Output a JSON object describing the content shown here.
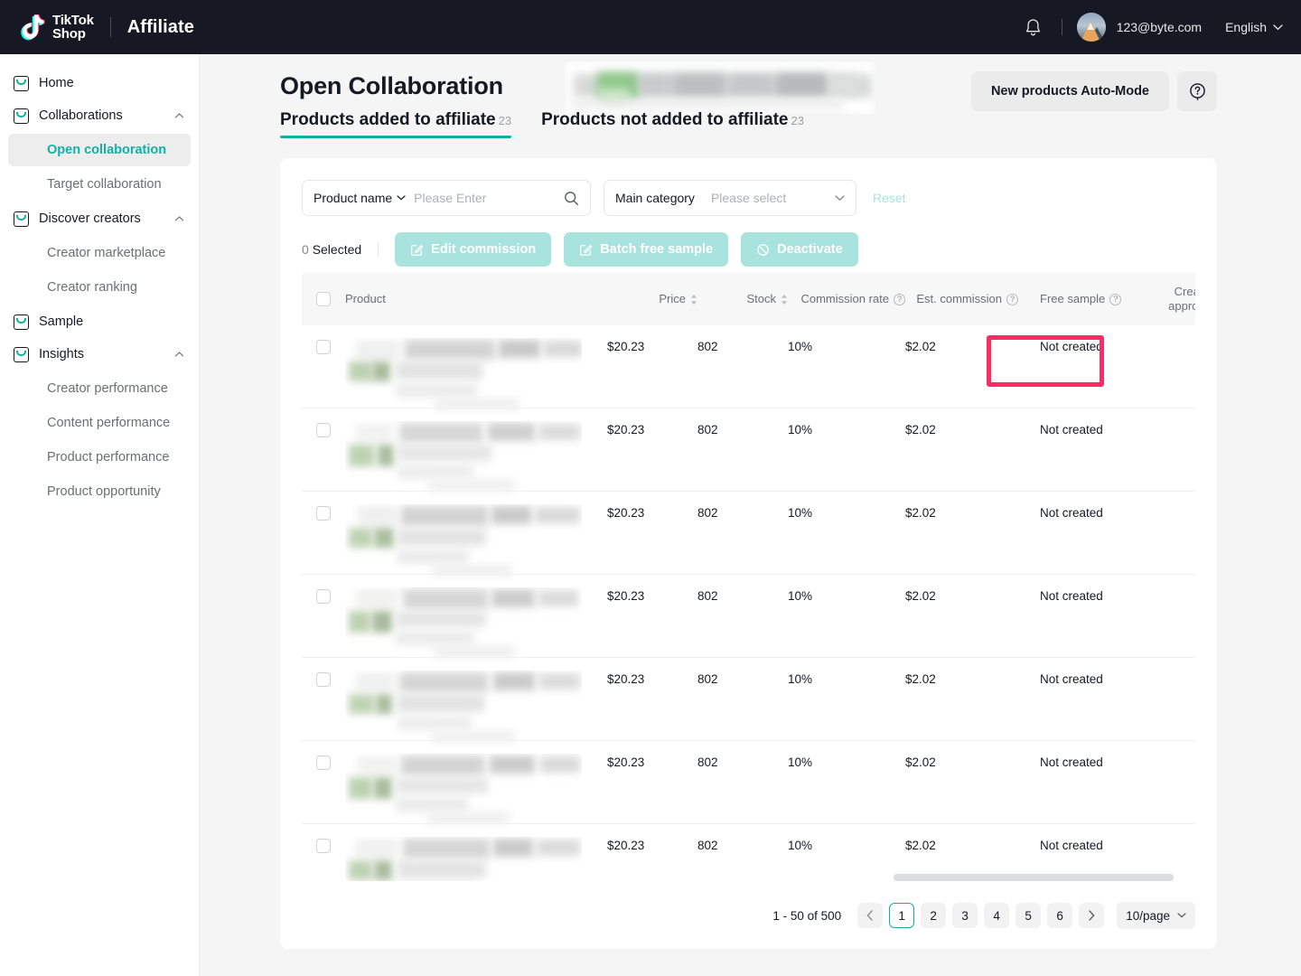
{
  "topbar": {
    "logo_line1": "TikTok",
    "logo_line2": "Shop",
    "app_title": "Affiliate",
    "user_email": "123@byte.com",
    "language": "English"
  },
  "sidebar": {
    "items": [
      {
        "label": "Home",
        "type": "top",
        "expandable": false
      },
      {
        "label": "Collaborations",
        "type": "top",
        "expandable": true,
        "expanded": true
      },
      {
        "label": "Open collaboration",
        "type": "sub",
        "active": true
      },
      {
        "label": "Target collaboration",
        "type": "sub",
        "active": false
      },
      {
        "label": "Discover creators",
        "type": "top",
        "expandable": true,
        "expanded": true
      },
      {
        "label": "Creator marketplace",
        "type": "sub",
        "active": false
      },
      {
        "label": "Creator ranking",
        "type": "sub",
        "active": false
      },
      {
        "label": "Sample",
        "type": "top",
        "expandable": false
      },
      {
        "label": "Insights",
        "type": "top",
        "expandable": true,
        "expanded": true
      },
      {
        "label": "Creator performance",
        "type": "sub",
        "active": false
      },
      {
        "label": "Content performance",
        "type": "sub",
        "active": false
      },
      {
        "label": "Product performance",
        "type": "sub",
        "active": false
      },
      {
        "label": "Product opportunity",
        "type": "sub",
        "active": false
      }
    ]
  },
  "page": {
    "title": "Open Collaboration",
    "auto_mode_button": "New products Auto-Mode",
    "help_icon": "question-circle-icon",
    "tabs": [
      {
        "label": "Products added to affiliate",
        "count": "23",
        "active": true
      },
      {
        "label": "Products not added to affiliate",
        "count": "23",
        "active": false
      }
    ]
  },
  "filters": {
    "product_name_label": "Product name",
    "product_name_placeholder": "Please Enter",
    "search_icon": "search-icon",
    "main_category_label": "Main category",
    "main_category_placeholder": "Please select",
    "reset_label": "Reset"
  },
  "actions": {
    "selected_count": "0",
    "selected_label": "Selected",
    "buttons": [
      {
        "label": "Edit commission",
        "icon": "edit-square-icon",
        "disabled": true
      },
      {
        "label": "Batch free sample",
        "icon": "edit-square-icon",
        "disabled": true
      },
      {
        "label": "Deactivate",
        "icon": "ban-circle-icon",
        "disabled": true
      }
    ]
  },
  "table": {
    "columns": [
      {
        "key": "checkbox",
        "label": "",
        "sortable": false
      },
      {
        "key": "product",
        "label": "Product",
        "sortable": false
      },
      {
        "key": "price",
        "label": "Price",
        "sortable": true
      },
      {
        "key": "stock",
        "label": "Stock",
        "sortable": true
      },
      {
        "key": "commission_rate",
        "label": "Commission rate",
        "sortable": false,
        "tooltip": true
      },
      {
        "key": "est_commission",
        "label": "Est. commission",
        "sortable": false,
        "tooltip": true
      },
      {
        "key": "free_sample",
        "label": "Free sample",
        "sortable": false,
        "tooltip": true
      },
      {
        "key": "creator_approval",
        "label": "Creator approval",
        "sortable": false,
        "truncated": true
      }
    ],
    "rows": [
      {
        "product": "",
        "price": "$20.23",
        "stock": "802",
        "commission_rate": "10%",
        "est_commission": "$2.02",
        "free_sample": "Not created",
        "highlighted": true
      },
      {
        "product": "",
        "price": "$20.23",
        "stock": "802",
        "commission_rate": "10%",
        "est_commission": "$2.02",
        "free_sample": "Not created",
        "highlighted": false
      },
      {
        "product": "",
        "price": "$20.23",
        "stock": "802",
        "commission_rate": "10%",
        "est_commission": "$2.02",
        "free_sample": "Not created",
        "highlighted": false
      },
      {
        "product": "",
        "price": "$20.23",
        "stock": "802",
        "commission_rate": "10%",
        "est_commission": "$2.02",
        "free_sample": "Not created",
        "highlighted": false
      },
      {
        "product": "",
        "price": "$20.23",
        "stock": "802",
        "commission_rate": "10%",
        "est_commission": "$2.02",
        "free_sample": "Not created",
        "highlighted": false
      },
      {
        "product": "",
        "price": "$20.23",
        "stock": "802",
        "commission_rate": "10%",
        "est_commission": "$2.02",
        "free_sample": "Not created",
        "highlighted": false
      },
      {
        "product": "",
        "price": "$20.23",
        "stock": "802",
        "commission_rate": "10%",
        "est_commission": "$2.02",
        "free_sample": "Not created",
        "highlighted": false
      }
    ]
  },
  "pagination": {
    "range": "1 - 50 of 500",
    "prev_icon": "chevron-left-icon",
    "next_icon": "chevron-right-icon",
    "pages": [
      "1",
      "2",
      "3",
      "4",
      "5",
      "6"
    ],
    "current_page": "1",
    "page_size": "10/page"
  },
  "colors": {
    "brand_teal": "#0fb1a6",
    "highlight_pink": "#fb2b65",
    "topbar_bg": "#161823",
    "disabled_mint": "#a9e3de"
  }
}
